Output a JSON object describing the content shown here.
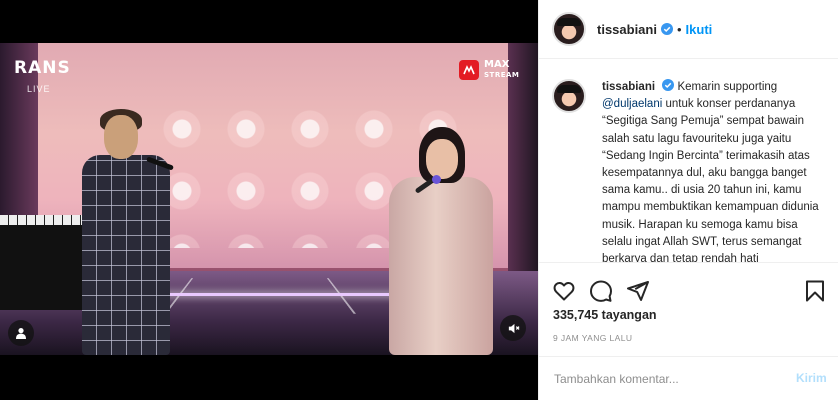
{
  "video": {
    "brand_logo": "RANS",
    "brand_sub": "LIVE",
    "stream_logo_line1": "MAX",
    "stream_logo_line2": "STREAM"
  },
  "header": {
    "username": "tissabiani",
    "separator": "•",
    "follow_label": "Ikuti"
  },
  "caption": {
    "username": "tissabiani",
    "text_part1": "Kemarin supporting ",
    "mention": "@duljaelani",
    "text_part2": " untuk konser perdananya “Segitiga Sang Pemuja” sempat bawain salah satu lagu favouriteku juga yaitu “Sedang Ingin Bercinta” terimakasih atas kesempatannya dul, aku bangga banget sama kamu.. di usia 20 tahun ini, kamu mampu membuktikan kemampuan didunia musik. Harapan ku semoga kamu bisa selalu ingat Allah SWT, terus semangat berkarya dan tetap rendah hati"
  },
  "stats": {
    "views": "335,745 tayangan",
    "time_ago": "9 JAM YANG LALU"
  },
  "comment": {
    "placeholder": "Tambahkan komentar...",
    "send_label": "Kirim"
  },
  "colors": {
    "accent": "#0095f6",
    "verified": "#3897f0",
    "send_disabled": "#b2dffc",
    "muted_text": "#8e8e8e"
  },
  "icons": [
    "user-tag-icon",
    "sound-off-icon",
    "heart-icon",
    "comment-icon",
    "share-icon",
    "bookmark-icon",
    "verified-icon"
  ]
}
